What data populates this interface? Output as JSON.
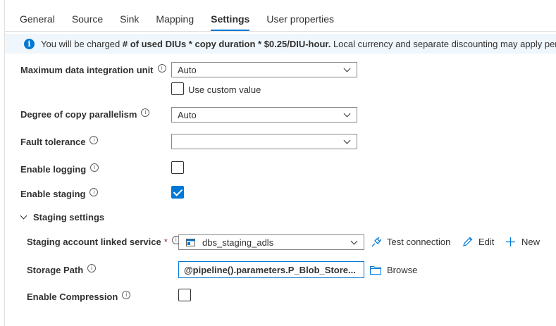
{
  "tabs": [
    {
      "label": "General"
    },
    {
      "label": "Source"
    },
    {
      "label": "Sink"
    },
    {
      "label": "Mapping"
    },
    {
      "label": "Settings",
      "active": true
    },
    {
      "label": "User properties"
    }
  ],
  "banner": {
    "icon": "info-icon",
    "prefix": "You will be charged ",
    "formula": "# of used DIUs * copy duration * $0.25/DIU-hour.",
    "suffix": " Local currency and separate discounting may apply per"
  },
  "settings": {
    "max_diu": {
      "label": "Maximum data integration unit",
      "value": "Auto",
      "custom_label": "Use custom value",
      "custom_checked": false
    },
    "parallelism": {
      "label": "Degree of copy parallelism",
      "value": "Auto"
    },
    "fault_tolerance": {
      "label": "Fault tolerance",
      "value": ""
    },
    "logging": {
      "label": "Enable logging",
      "checked": false
    },
    "staging": {
      "label": "Enable staging",
      "checked": true
    }
  },
  "staging_settings": {
    "header": "Staging settings",
    "linked_service": {
      "label": "Staging account linked service",
      "required_mark": "*",
      "value": "dbs_staging_adls",
      "test_connection": "Test connection",
      "edit": "Edit",
      "new": "New"
    },
    "storage_path": {
      "label": "Storage Path",
      "value": "@pipeline().parameters.P_Blob_Store...",
      "browse": "Browse"
    },
    "compression": {
      "label": "Enable Compression",
      "checked": false
    }
  },
  "colors": {
    "accent": "#0078d4",
    "banner_bg": "#eff6fc",
    "required": "#a4262c"
  }
}
